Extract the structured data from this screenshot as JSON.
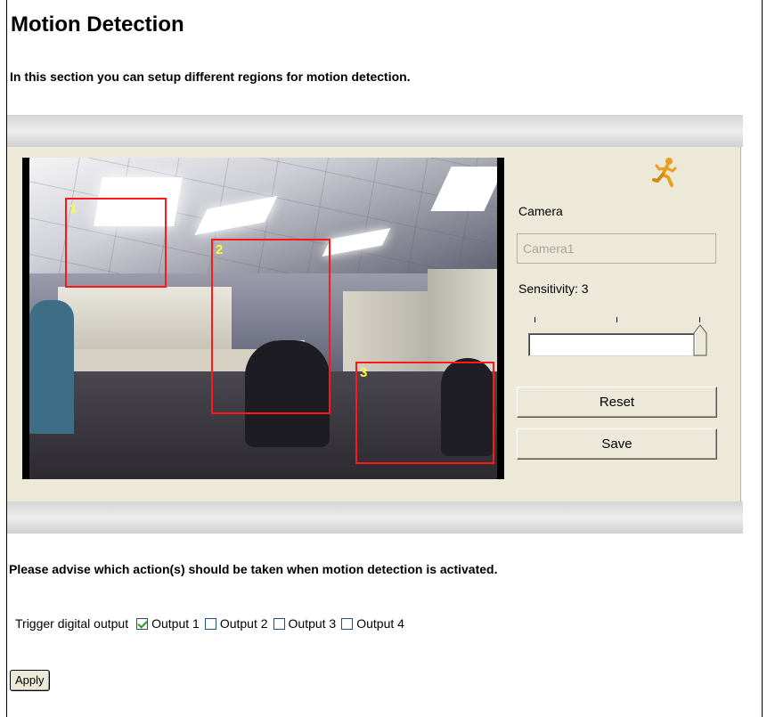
{
  "page": {
    "title": "Motion Detection",
    "intro": "In this section you can setup different regions for motion detection."
  },
  "video": {
    "regions": [
      "1",
      "2",
      "3"
    ]
  },
  "controls": {
    "camera_label": "Camera",
    "camera_value": "Camera1",
    "sensitivity_label": "Sensitivity: 3",
    "sensitivity_value": 3,
    "sensitivity_max": 3,
    "reset_label": "Reset",
    "save_label": "Save"
  },
  "actions": {
    "advise": "Please advise which action(s) should be taken when motion detection is activated.",
    "trigger_label": "Trigger digital output",
    "outputs": [
      {
        "label": "Output 1",
        "checked": true
      },
      {
        "label": "Output 2",
        "checked": false
      },
      {
        "label": "Output 3",
        "checked": false
      },
      {
        "label": "Output 4",
        "checked": false
      }
    ],
    "apply_label": "Apply"
  },
  "colors": {
    "panel": "#ece9d8",
    "region_border": "#ff1818",
    "region_label": "#ffff33",
    "check": "#21a121"
  },
  "icons": {
    "motion": "running-man-icon"
  }
}
